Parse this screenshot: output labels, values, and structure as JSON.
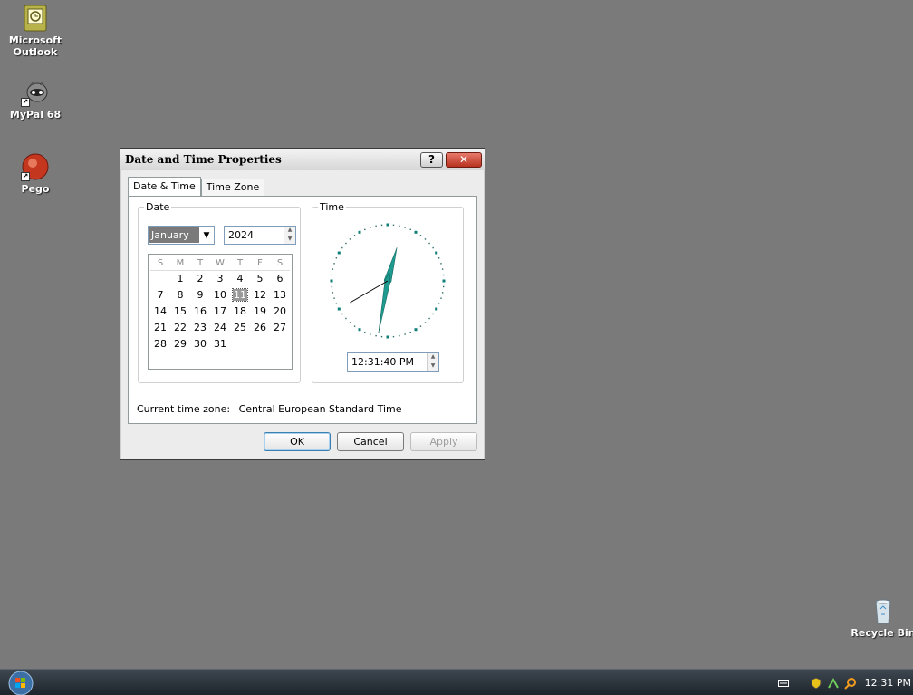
{
  "desktop": {
    "icons": [
      {
        "label_1": "Microsoft",
        "label_2": "Outlook",
        "icon": "outlook-icon"
      },
      {
        "label_1": "MyPal 68",
        "icon": "mypal-icon"
      },
      {
        "label_1": "Pego",
        "icon": "pego-icon"
      },
      {
        "label_1": "Recycle Bin",
        "icon": "recycle-bin-icon"
      }
    ]
  },
  "dialog": {
    "title": "Date and Time Properties",
    "help_symbol": "?",
    "close_symbol": "✕",
    "tabs": [
      "Date & Time",
      "Time Zone"
    ],
    "date_group": "Date",
    "time_group": "Time",
    "month": "January",
    "year": "2024",
    "weekday_headers": [
      "S",
      "M",
      "T",
      "W",
      "T",
      "F",
      "S"
    ],
    "weeks": [
      [
        "",
        "1",
        "2",
        "3",
        "4",
        "5",
        "6"
      ],
      [
        "7",
        "8",
        "9",
        "10",
        "11",
        "12",
        "13"
      ],
      [
        "14",
        "15",
        "16",
        "17",
        "18",
        "19",
        "20"
      ],
      [
        "21",
        "22",
        "23",
        "24",
        "25",
        "26",
        "27"
      ],
      [
        "28",
        "29",
        "30",
        "31",
        "",
        "",
        ""
      ]
    ],
    "selected_day": "11",
    "time_value": "12:31:40 PM",
    "time_zone_label": "Current time zone:",
    "time_zone_value": "Central European Standard Time",
    "buttons": {
      "ok": "OK",
      "cancel": "Cancel",
      "apply": "Apply"
    }
  },
  "clock": {
    "hours": 12,
    "minutes": 31,
    "seconds": 40,
    "hand_color": "#1e9a8e"
  },
  "taskbar": {
    "clock_text": "12:31 PM"
  }
}
